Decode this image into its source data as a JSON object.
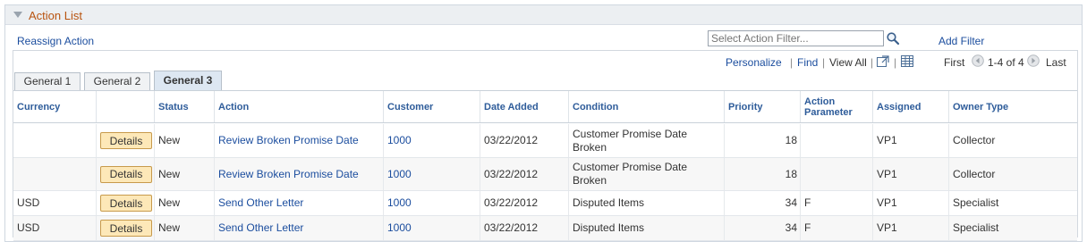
{
  "panel": {
    "title": "Action List"
  },
  "toolbar": {
    "reassign_label": "Reassign Action",
    "filter_placeholder": "Select Action Filter...",
    "add_filter_label": "Add Filter"
  },
  "grid_bar": {
    "personalize": "Personalize",
    "find": "Find",
    "view_all": "View All",
    "first": "First",
    "range": "1-4 of 4",
    "last": "Last"
  },
  "tabs": [
    {
      "label": "General 1",
      "active": false
    },
    {
      "label": "General 2",
      "active": false
    },
    {
      "label": "General 3",
      "active": true
    }
  ],
  "columns": [
    "Currency",
    "",
    "Status",
    "Action",
    "Customer",
    "Date Added",
    "Condition",
    "Priority",
    "Action Parameter",
    "Assigned",
    "Owner Type"
  ],
  "rows": [
    {
      "currency": "",
      "button": "Details",
      "status": "New",
      "action": "Review Broken Promise Date",
      "customer": "1000",
      "date_added": "03/22/2012",
      "condition": "Customer Promise Date Broken",
      "priority": "18",
      "parameter": "",
      "assigned": "VP1",
      "owner_type": "Collector"
    },
    {
      "currency": "",
      "button": "Details",
      "status": "New",
      "action": "Review Broken Promise Date",
      "customer": "1000",
      "date_added": "03/22/2012",
      "condition": "Customer Promise Date Broken",
      "priority": "18",
      "parameter": "",
      "assigned": "VP1",
      "owner_type": "Collector"
    },
    {
      "currency": "USD",
      "button": "Details",
      "status": "New",
      "action": "Send Other Letter",
      "customer": "1000",
      "date_added": "03/22/2012",
      "condition": "Disputed Items",
      "priority": "34",
      "parameter": "F",
      "assigned": "VP1",
      "owner_type": "Specialist"
    },
    {
      "currency": "USD",
      "button": "Details",
      "status": "New",
      "action": "Send Other Letter",
      "customer": "1000",
      "date_added": "03/22/2012",
      "condition": "Disputed Items",
      "priority": "34",
      "parameter": "F",
      "assigned": "VP1",
      "owner_type": "Specialist"
    }
  ],
  "icons": {
    "collapse": "triangle-down-icon",
    "search": "magnifier-icon",
    "zoom": "new-window-icon",
    "download": "grid-download-icon",
    "prev": "arrow-left-icon",
    "next": "arrow-right-icon"
  },
  "colors": {
    "title": "#b8530f",
    "link": "#1b4d9e",
    "header_text": "#2e5c9a",
    "button_bg": "#fde8b8",
    "active_tab": "#dde7f2"
  }
}
